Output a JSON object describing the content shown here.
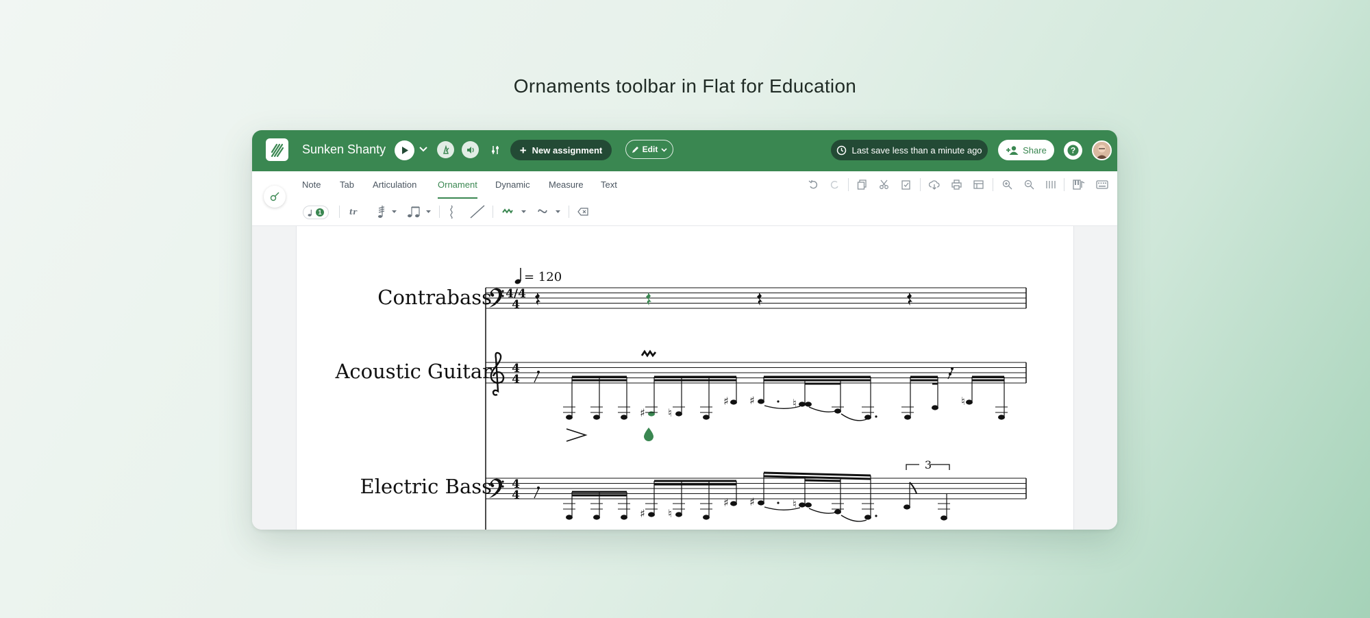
{
  "caption": "Ornaments toolbar in Flat for Education",
  "header": {
    "score_title": "Sunken Shanty",
    "new_assignment_label": "New assignment",
    "edit_label": "Edit",
    "save_status": "Last save less than a minute ago",
    "share_label": "Share"
  },
  "toolbar": {
    "tabs": [
      {
        "label": "Note"
      },
      {
        "label": "Tab"
      },
      {
        "label": "Articulation"
      },
      {
        "label": "Ornament",
        "active": true
      },
      {
        "label": "Dynamic"
      },
      {
        "label": "Measure"
      },
      {
        "label": "Text"
      }
    ],
    "voice_number": "1",
    "ornament_tools": [
      "trill-icon",
      "tremolo-icon",
      "grace-note-icon",
      "arpeggio-icon",
      "glissando-icon",
      "mordent-icon",
      "turn-icon",
      "remove-icon"
    ],
    "right_tools": [
      "undo-icon",
      "redo-icon",
      "copy-icon",
      "cut-icon",
      "paste-icon",
      "download-icon",
      "print-icon",
      "layout-icon",
      "zoom-in-icon",
      "zoom-out-icon",
      "metronome-icon",
      "piano-icon",
      "keyboard-icon"
    ]
  },
  "score": {
    "tempo_value": "= 120",
    "time_signature": "4/4",
    "tuplet_number": "3",
    "instruments": [
      {
        "name": "Contrabass",
        "clef": "bass"
      },
      {
        "name": "Acoustic Guitar",
        "clef": "treble"
      },
      {
        "name": "Electric Bass",
        "clef": "bass"
      }
    ]
  },
  "colors": {
    "brand_green": "#3a8751",
    "dark_green": "#234a35"
  }
}
